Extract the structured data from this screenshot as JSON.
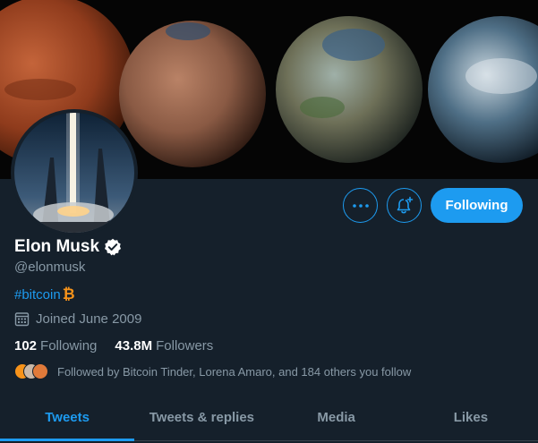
{
  "profile": {
    "name": "Elon Musk",
    "handle": "@elonmusk",
    "bio_hashtag": "#bitcoin",
    "bio_emoji": "₿",
    "joined": "Joined June 2009",
    "verified_icon": "verified-badge-icon"
  },
  "actions": {
    "more_icon": "more-options-icon",
    "notify_icon": "bell-plus-icon",
    "following_label": "Following"
  },
  "stats": {
    "following_count": "102",
    "following_label": "Following",
    "followers_count": "43.8M",
    "followers_label": "Followers"
  },
  "followed_by": {
    "text": "Followed by Bitcoin Tinder, Lorena Amaro, and 184 others you follow"
  },
  "tabs": [
    {
      "label": "Tweets",
      "active": true
    },
    {
      "label": "Tweets & replies",
      "active": false
    },
    {
      "label": "Media",
      "active": false
    },
    {
      "label": "Likes",
      "active": false
    }
  ],
  "colors": {
    "background": "#15202b",
    "accent": "#1d9bf0",
    "muted": "#8899a6",
    "bitcoin": "#f7931a"
  }
}
